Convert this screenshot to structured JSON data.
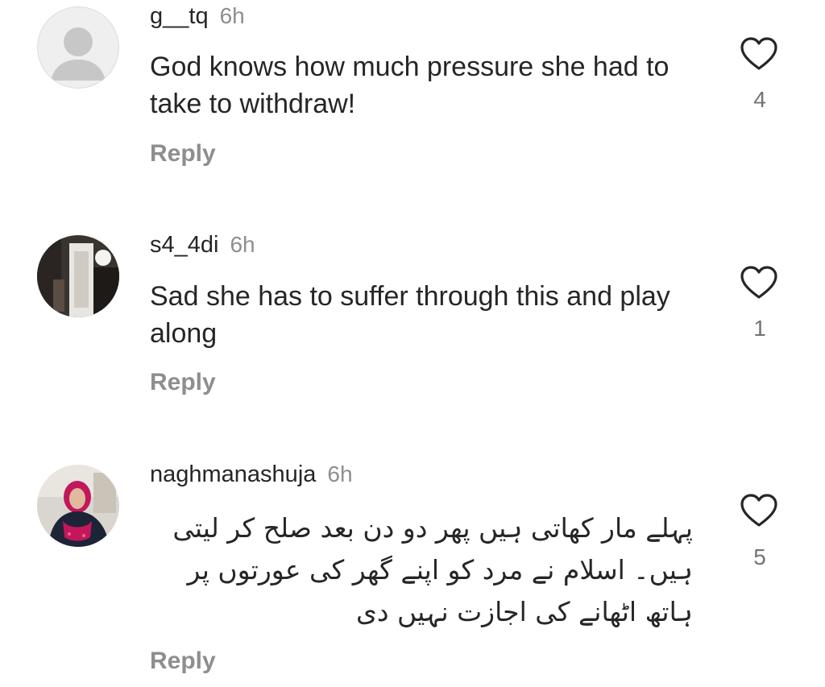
{
  "comments": [
    {
      "username": "g__tq",
      "time": "6h",
      "text": "God knows how much pressure she had to take to withdraw!",
      "likes": "4",
      "reply": "Reply",
      "avatar": "default-avatar"
    },
    {
      "username": "s4_4di",
      "time": "6h",
      "text": "Sad she has to suffer through this and play along",
      "likes": "1",
      "reply": "Reply",
      "avatar": "photo-avatar"
    },
    {
      "username": "naghmanashuja",
      "time": "6h",
      "text": "پہلے مار کھاتی ہیں پھر دو دن بعد صلح کر لیتی ہیں۔ اسلام نے مرد کو اپنے گھر کی عورتوں پر ہاتھ اٹھانے کی اجازت نہیں دی",
      "likes": "5",
      "reply": "Reply",
      "avatar": "photo-avatar"
    }
  ],
  "icons": {
    "like": "heart-outline-icon"
  },
  "colors": {
    "text": "#262626",
    "muted": "#8e8e8e",
    "count": "#737373"
  }
}
